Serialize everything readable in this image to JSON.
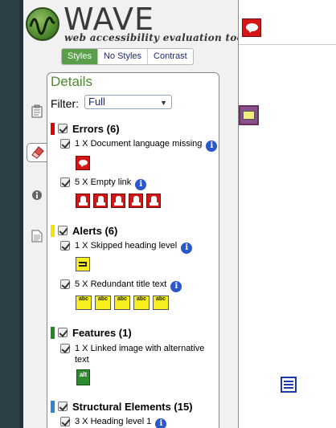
{
  "logo": {
    "wordmark": "WAVE",
    "tagline": "web accessibility evaluation tool"
  },
  "style_tabs": [
    {
      "label": "Styles",
      "active": true
    },
    {
      "label": "No Styles",
      "active": false
    },
    {
      "label": "Contrast",
      "active": false
    }
  ],
  "panel": {
    "title": "Details",
    "filter_label": "Filter:",
    "filter_value": "Full"
  },
  "categories": {
    "errors": {
      "label": "Errors (6)",
      "color": "#e00000"
    },
    "alerts": {
      "label": "Alerts (6)",
      "color": "#f2e400"
    },
    "features": {
      "label": "Features (1)",
      "color": "#1f8a1f"
    },
    "structural": {
      "label": "Structural Elements (15)",
      "color": "#2a86d6"
    }
  },
  "items": {
    "doc_lang": "1 X Document language missing",
    "empty_link": "5 X Empty link",
    "skipped_heading": "1 X Skipped heading level",
    "redundant_title": "5 X Redundant title text",
    "linked_image": "1 X Linked image with alternative text",
    "heading1": "3 X Heading level 1"
  },
  "icon_text": {
    "title_icon": "abc",
    "feature_icon": "alt"
  },
  "icons": [
    "clipboard-icon",
    "eraser-icon",
    "info-icon",
    "document-icon",
    "error-speech-icon",
    "empty-link-icon",
    "alert-skip-icon",
    "redundant-title-icon",
    "linked-image-icon",
    "list-icon"
  ]
}
